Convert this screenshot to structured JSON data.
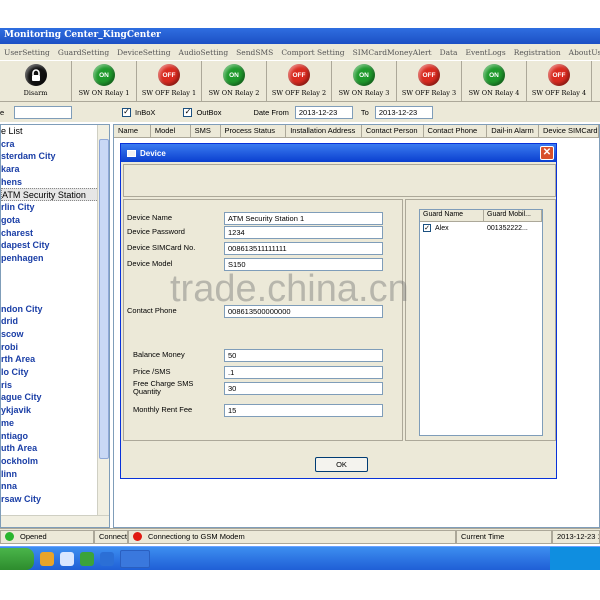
{
  "window": {
    "title": "Monitoring Center_KingCenter"
  },
  "menu": [
    "UserSetting",
    "GuardSetting",
    "DeviceSetting",
    "AudioSetting",
    "SendSMS",
    "Comport Setting",
    "SIMCardMoneyAlert",
    "Data",
    "EventLogs",
    "Registration",
    "AboutUs"
  ],
  "toolbar": [
    {
      "icon": "lock-icon",
      "badge": "",
      "color": "black",
      "label": "Disarm"
    },
    {
      "icon": "on-icon",
      "badge": "ON",
      "color": "green",
      "label": "SW ON Relay 1"
    },
    {
      "icon": "off-icon",
      "badge": "OFF",
      "color": "red",
      "label": "SW OFF Relay 1"
    },
    {
      "icon": "on-icon",
      "badge": "ON",
      "color": "green",
      "label": "SW ON Relay 2"
    },
    {
      "icon": "off-icon",
      "badge": "OFF",
      "color": "red",
      "label": "SW OFF Relay 2"
    },
    {
      "icon": "on-icon",
      "badge": "ON",
      "color": "green",
      "label": "SW ON Relay 3"
    },
    {
      "icon": "off-icon",
      "badge": "OFF",
      "color": "red",
      "label": "SW OFF Relay 3"
    },
    {
      "icon": "on-icon",
      "badge": "ON",
      "color": "green",
      "label": "SW ON Relay 4"
    },
    {
      "icon": "off-icon",
      "badge": "OFF",
      "color": "red",
      "label": "SW OFF Relay 4"
    }
  ],
  "filter": {
    "prefix": "e",
    "inbox_label": "InBoX",
    "outbox_label": "OutBox",
    "date_from_label": "Date From",
    "date_from": "2013-12-23",
    "to_label": "To",
    "date_to": "2013-12-23"
  },
  "tree": {
    "header": "e List",
    "items": [
      "cra",
      "sterdam City",
      "kara",
      "hens",
      "ATM Security Station",
      "rlin City",
      "gota",
      "charest",
      "dapest City",
      "penhagen",
      "",
      "",
      "",
      "ndon City",
      "drid",
      "scow",
      "robi",
      "rth Area",
      "lo City",
      "ris",
      "ague City",
      "ykjavik",
      "me",
      "ntiago",
      "uth Area",
      "ockholm",
      "linn",
      "nna",
      "rsaw City"
    ],
    "selected_index": 4
  },
  "grid_columns": [
    "Name",
    "Model",
    "SMS",
    "Process Status",
    "Installation Address",
    "Contact Person",
    "Contact Phone",
    "Dail-in Alarm",
    "Device SIMCard"
  ],
  "dialog": {
    "title": "Device",
    "fields": [
      {
        "label": "Device Name",
        "value": "ATM Security Station 1"
      },
      {
        "label": "Device Password",
        "value": "1234"
      },
      {
        "label": "Device SIMCard No.",
        "value": "008613511111111"
      },
      {
        "label": "Device Model",
        "value": "S150"
      },
      {
        "label": "Contact Phone",
        "value": "008613500000000"
      },
      {
        "label": "Balance Money",
        "value": "50"
      },
      {
        "label": "Price /SMS",
        "value": ".1"
      },
      {
        "label": "Free Charge SMS Quantity",
        "value": "30"
      },
      {
        "label": "Monthly Rent Fee",
        "value": "15"
      }
    ],
    "guard_columns": [
      "Guard Name",
      "Guard Mobil..."
    ],
    "guards": [
      {
        "checked": true,
        "name": "Alex",
        "mobile": "001352222..."
      }
    ],
    "ok_label": "OK"
  },
  "status": {
    "opened": "Opened",
    "connect": "Connect",
    "modem": "Connectiong to GSM Modem",
    "current_time_label": "Current Time",
    "current_time": "2013-12-23 1"
  },
  "watermark": "trade.china.cn",
  "colors": {
    "on": "#1f9a2c",
    "off": "#d92a1f",
    "tree_text": "#1a3ea6",
    "title_blue": "#1c4fc4"
  }
}
